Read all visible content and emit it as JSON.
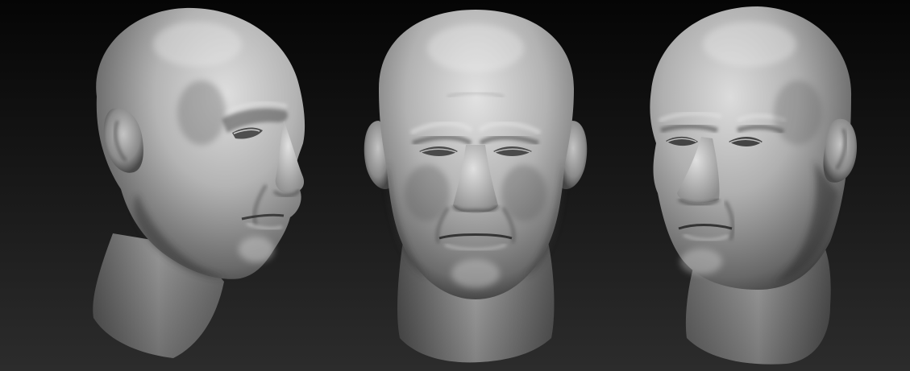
{
  "scene": {
    "background_top": "#050505",
    "background_bottom": "#2c2c2c",
    "material_light": "#d6d6d6",
    "material_mid": "#8a8a8a",
    "material_dark": "#2a2a2a"
  },
  "heads": [
    {
      "view": "three-quarter-right"
    },
    {
      "view": "front"
    },
    {
      "view": "three-quarter-left"
    }
  ]
}
